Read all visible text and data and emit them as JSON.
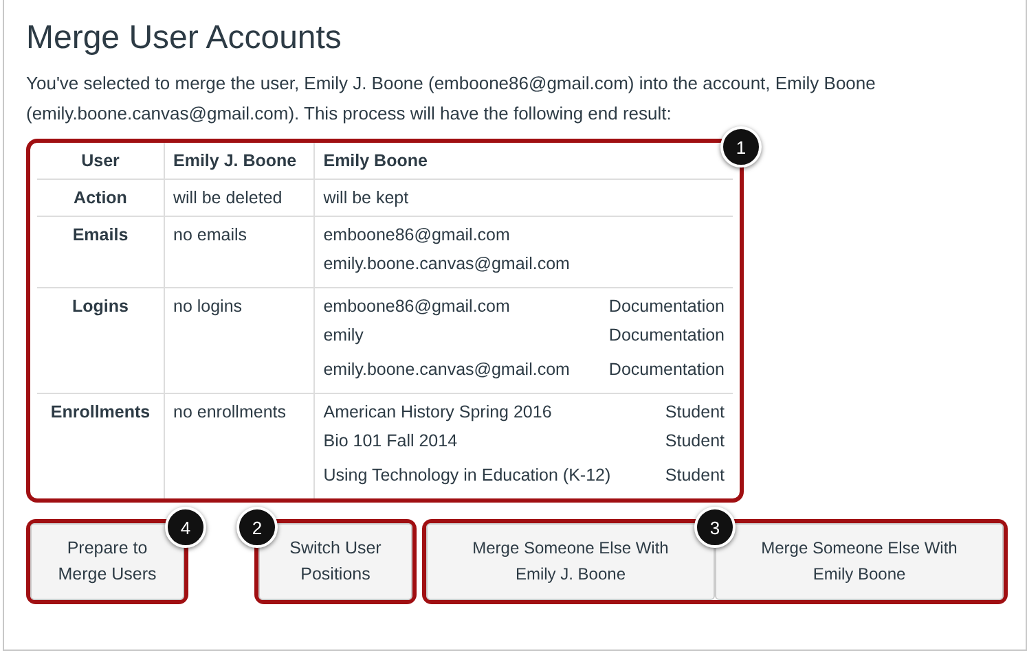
{
  "title": "Merge User Accounts",
  "intro": "You've selected to merge the user, Emily J. Boone (emboone86@gmail.com) into the account, Emily Boone (emily.boone.canvas@gmail.com). This process will have the following end result:",
  "table": {
    "callout": "1",
    "columns": [
      "User",
      "Emily J. Boone",
      "Emily Boone"
    ],
    "rows": [
      {
        "label": "Action",
        "left": "will be deleted",
        "right": [
          {
            "primary": "will be kept"
          }
        ]
      },
      {
        "label": "Emails",
        "left": "no emails",
        "right": [
          {
            "primary": "emboone86@gmail.com"
          },
          {
            "primary": "emily.boone.canvas@gmail.com"
          }
        ]
      },
      {
        "label": "Logins",
        "left": "no logins",
        "right": [
          {
            "primary": "emboone86@gmail.com",
            "secondary": "Documentation"
          },
          {
            "primary": "emily",
            "secondary": "Documentation"
          },
          {
            "primary": "emily.boone.canvas@gmail.com",
            "secondary": "Documentation"
          }
        ]
      },
      {
        "label": "Enrollments",
        "left": "no enrollments",
        "right": [
          {
            "primary": "American History Spring 2016",
            "secondary": "Student"
          },
          {
            "primary": "Bio 101 Fall 2014",
            "secondary": "Student"
          },
          {
            "primary": "Using Technology in Education (K-12)",
            "secondary": "Student"
          }
        ]
      }
    ]
  },
  "button_groups": [
    {
      "callout": "4",
      "buttons": [
        "Prepare to Merge Users"
      ]
    },
    {
      "callout": "2",
      "buttons": [
        "Switch User Positions"
      ]
    },
    {
      "callout": "3",
      "buttons": [
        "Merge Someone Else With Emily J. Boone",
        "Merge Someone Else With Emily Boone"
      ]
    }
  ]
}
